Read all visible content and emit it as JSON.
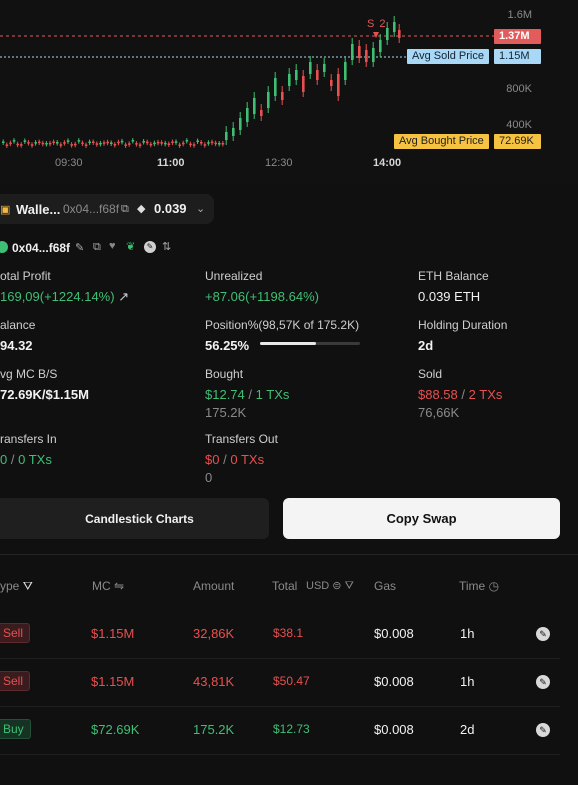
{
  "chart": {
    "y_ticks": [
      "1.6M",
      "800K",
      "400K"
    ],
    "x_ticks": [
      "09:30",
      "11:00",
      "12:30",
      "14:00"
    ],
    "bold_x_ticks": [
      "11:00",
      "14:00"
    ],
    "current_price": "1.37M",
    "avg_sold_label": "Avg Sold Price",
    "avg_sold_value": "1.15M",
    "avg_bought_label": "Avg Bought Price",
    "avg_bought_value": "72.69K",
    "marker": "S 2",
    "colors": {
      "up": "#3fbf74",
      "down": "#ea4f4f",
      "sold": "#a8d8f5",
      "bought": "#f5c242",
      "current": "#e25c5c"
    }
  },
  "wallet": {
    "name": "Walle...",
    "address": "0x04...f68f",
    "balance": "0.039",
    "short_address": "0x04...f68f"
  },
  "stats": {
    "total_profit_label": "otal Profit",
    "total_profit_value": "169,09(+1224.14%)",
    "unrealized_label": "Unrealized",
    "unrealized_value": "+87.06(+1198.64%)",
    "eth_balance_label": "ETH Balance",
    "eth_balance_value": "0.039 ETH",
    "balance_label": "alance",
    "balance_value": "94.32",
    "position_label": "Position%(98,57K of 175.2K)",
    "position_value": "56.25%",
    "position_fraction": 0.5625,
    "holding_label": "Holding Duration",
    "holding_value": "2d",
    "avg_mc_label": "vg MC B/S",
    "avg_mc_value": "72.69K/$1.15M",
    "bought_label": "Bought",
    "bought_amount": "$12.74",
    "bought_txs": "1 TXs",
    "bought_tokens": "175.2K",
    "sold_label": "Sold",
    "sold_amount": "$88.58",
    "sold_txs": "2 TXs",
    "sold_tokens": "76,66K",
    "transfers_in_label": "ransfers In",
    "transfers_in_amount": "0",
    "transfers_in_txs": "0 TXs",
    "transfers_in_sub": "",
    "transfers_out_label": "Transfers Out",
    "transfers_out_amount": "$0",
    "transfers_out_txs": "0 TXs",
    "transfers_out_sub": "0",
    "slash": "/"
  },
  "buttons": {
    "candlestick": "Candlestick Charts",
    "copy_swap": "Copy Swap"
  },
  "table": {
    "headers": {
      "type": "ype",
      "mc": "MC",
      "amount": "Amount",
      "total": "Total",
      "usd": "USD",
      "gas": "Gas",
      "time": "Time"
    },
    "rows": [
      {
        "type": "Sell",
        "mc": "$1.15M",
        "amount": "32,86K",
        "total": "$38.1",
        "gas": "$0.008",
        "time": "1h"
      },
      {
        "type": "Sell",
        "mc": "$1.15M",
        "amount": "43,81K",
        "total": "$50.47",
        "gas": "$0.008",
        "time": "1h"
      },
      {
        "type": "Buy",
        "mc": "$72.69K",
        "amount": "175.2K",
        "total": "$12.73",
        "gas": "$0.008",
        "time": "2d"
      }
    ]
  },
  "icons": {
    "wallet": "wallet-icon",
    "copy": "copy-icon",
    "eth": "eth-icon",
    "chevron": "chevron-down-icon",
    "edit": "edit-icon",
    "heart": "heart-icon",
    "leaf": "leaf-icon",
    "gear": "swap-icon",
    "filter": "filter-icon",
    "swap_arrows": "swap-arrows-icon",
    "clock": "clock-icon",
    "explorer": "explorer-icon"
  }
}
